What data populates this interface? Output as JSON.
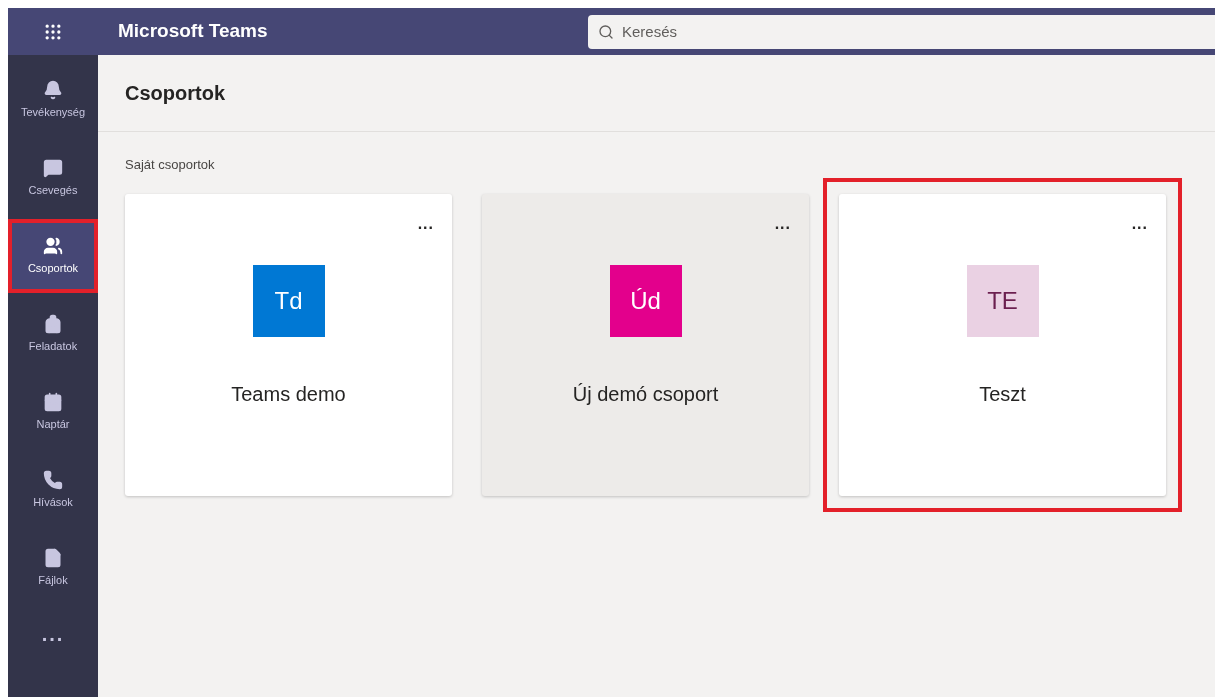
{
  "app_title": "Microsoft Teams",
  "search": {
    "placeholder": "Keresés"
  },
  "rail": [
    {
      "kind": "bell",
      "label": "Tevékenység",
      "selected": false,
      "highlighted": false
    },
    {
      "kind": "chat",
      "label": "Csevegés",
      "selected": false,
      "highlighted": false
    },
    {
      "kind": "teams",
      "label": "Csoportok",
      "selected": true,
      "highlighted": true
    },
    {
      "kind": "tasks",
      "label": "Feladatok",
      "selected": false,
      "highlighted": false
    },
    {
      "kind": "calendar",
      "label": "Naptár",
      "selected": false,
      "highlighted": false
    },
    {
      "kind": "calls",
      "label": "Hívások",
      "selected": false,
      "highlighted": false
    },
    {
      "kind": "files",
      "label": "Fájlok",
      "selected": false,
      "highlighted": false
    }
  ],
  "rail_more": "...",
  "page_title": "Csoportok",
  "section_label": "Saját csoportok",
  "teams": [
    {
      "initials": "Td",
      "name": "Teams demo",
      "color": "#0078d4",
      "hovered": false,
      "highlighted": false
    },
    {
      "initials": "Úd",
      "name": "Új demó csoport",
      "color": "#e3008c",
      "hovered": true,
      "highlighted": false
    },
    {
      "initials": "TE",
      "name": "Teszt",
      "color": "#ead1e3",
      "hovered": false,
      "highlighted": true
    }
  ],
  "card_menu": "..."
}
